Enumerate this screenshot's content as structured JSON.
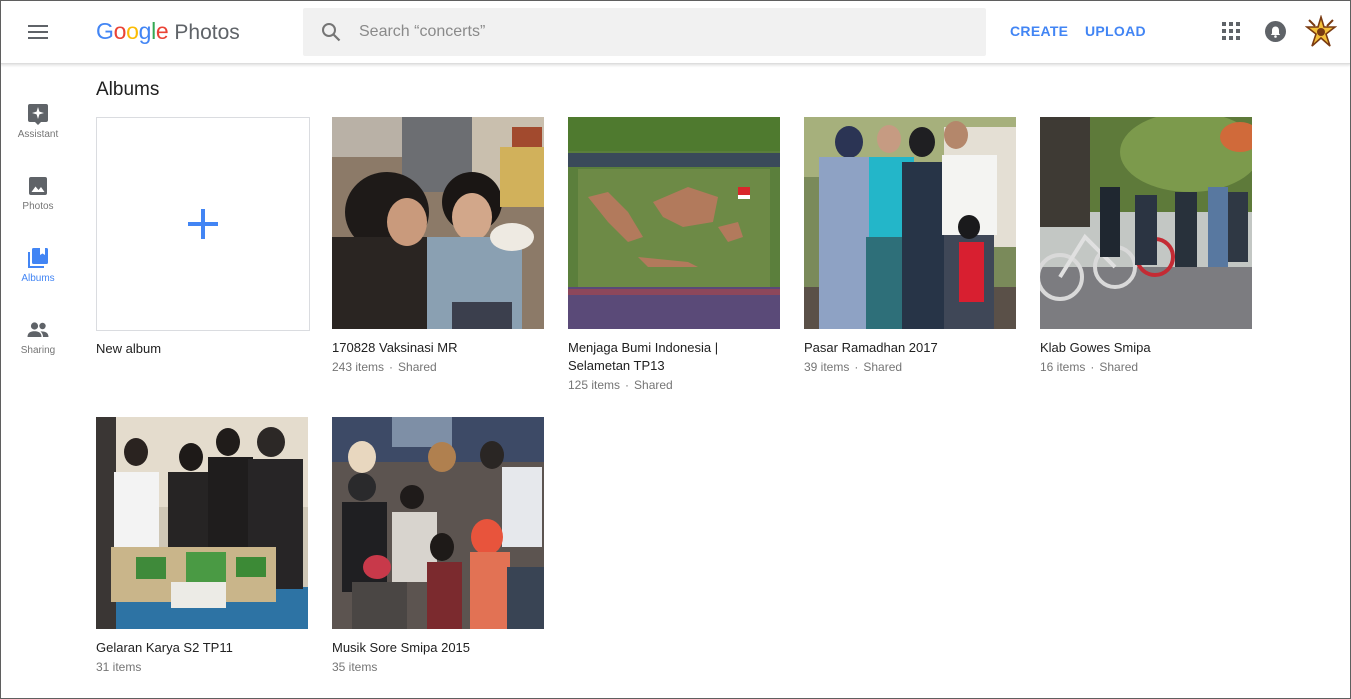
{
  "app": {
    "logo_google": [
      "G",
      "o",
      "o",
      "g",
      "l",
      "e"
    ],
    "logo_colors": [
      "#4285f4",
      "#ea4335",
      "#fbbc05",
      "#4285f4",
      "#34a853",
      "#ea4335"
    ],
    "logo_product": "Photos",
    "accent": "#4285f4"
  },
  "header": {
    "menu_icon": "hamburger-menu-icon",
    "search_placeholder": "Search “concerts”",
    "search_icon": "search-icon",
    "create_label": "CREATE",
    "upload_label": "UPLOAD",
    "apps_icon": "apps-grid-icon",
    "notifications_icon": "bell-icon",
    "avatar_icon": "profile-avatar"
  },
  "sidebar": {
    "items": [
      {
        "label": "Assistant",
        "icon": "assistant-icon",
        "active": false
      },
      {
        "label": "Photos",
        "icon": "photo-icon",
        "active": false
      },
      {
        "label": "Albums",
        "icon": "albums-icon",
        "active": true
      },
      {
        "label": "Sharing",
        "icon": "people-icon",
        "active": false
      }
    ]
  },
  "main": {
    "title": "Albums",
    "new_album_label": "New album",
    "albums": [
      {
        "name": "170828 Vaksinasi MR",
        "count": "243 items",
        "shared": "Shared"
      },
      {
        "name": "Menjaga Bumi Indonesia | Selametan TP13",
        "count": "125 items",
        "shared": "Shared"
      },
      {
        "name": "Pasar Ramadhan 2017",
        "count": "39 items",
        "shared": "Shared"
      },
      {
        "name": "Klab Gowes Smipa",
        "count": "16 items",
        "shared": "Shared"
      },
      {
        "name": "Gelaran Karya S2 TP11",
        "count": "31 items",
        "shared": ""
      },
      {
        "name": "Musik Sore Smipa 2015",
        "count": "35 items",
        "shared": ""
      }
    ]
  }
}
